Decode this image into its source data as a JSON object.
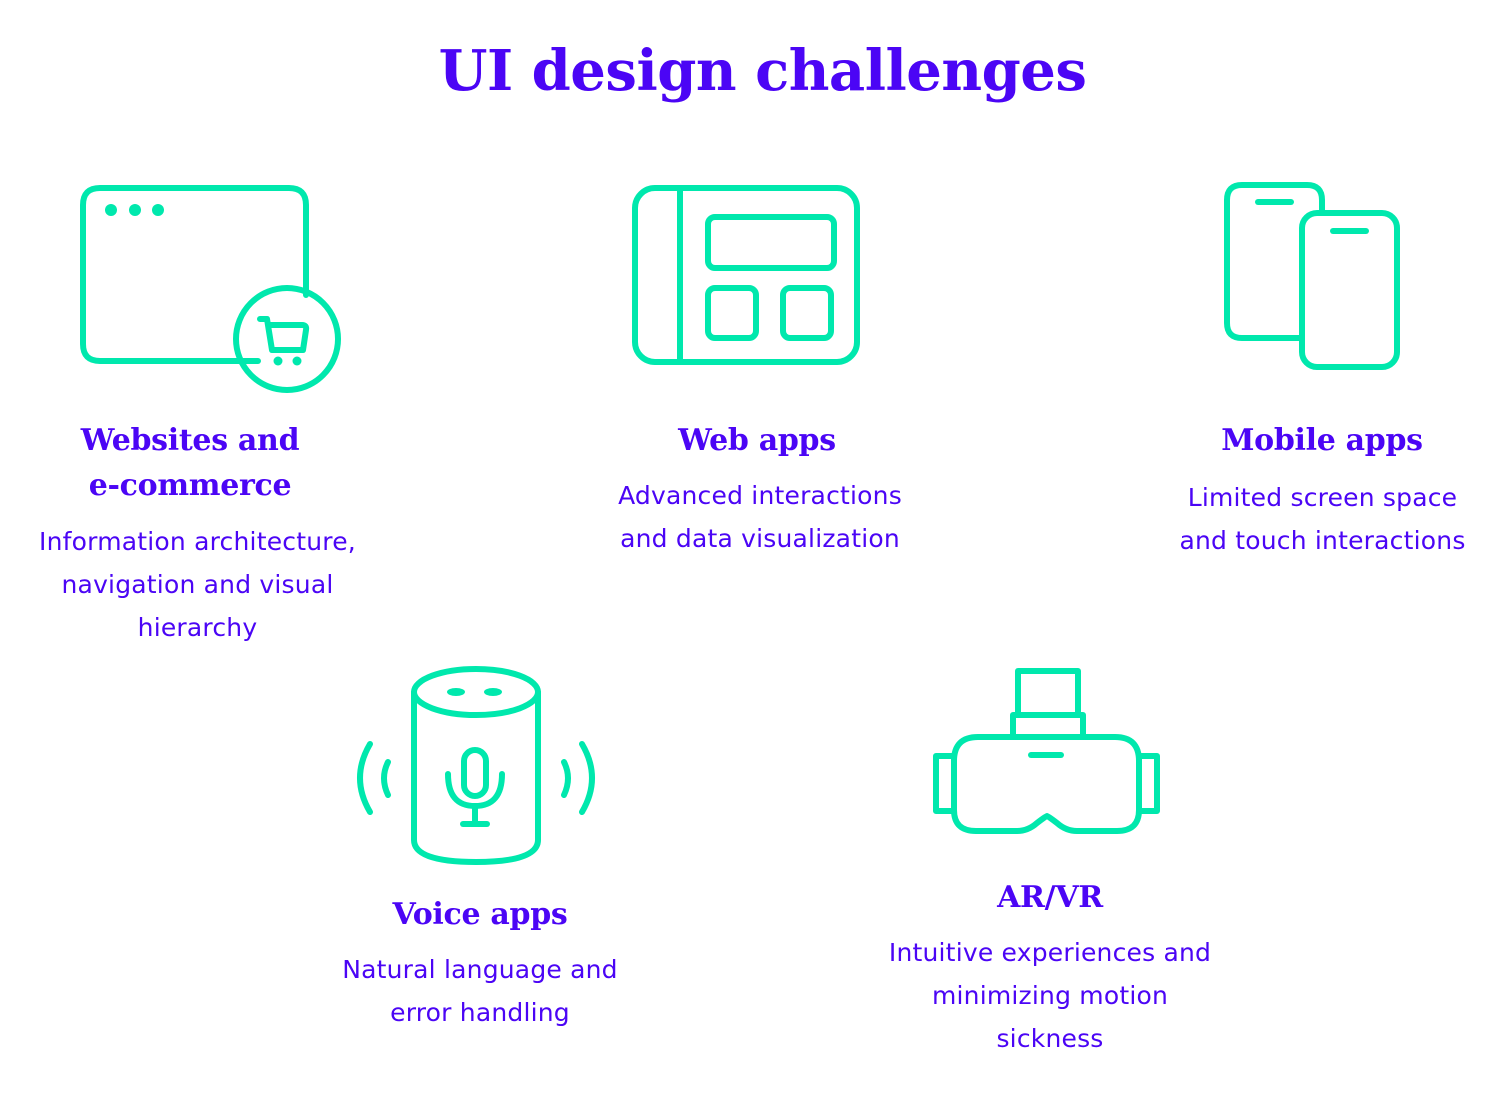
{
  "title": "UI design challenges",
  "colors": {
    "heading": "#4b05f5",
    "icon": "#00e8ad",
    "background": "#ffffff"
  },
  "cards": [
    {
      "icon": "browser-cart-icon",
      "title_lines": [
        "Websites and",
        "e-commerce"
      ],
      "desc_lines": [
        "Information architecture,",
        "navigation and visual",
        "hierarchy"
      ]
    },
    {
      "icon": "web-app-layout-icon",
      "title_lines": [
        "Web apps"
      ],
      "desc_lines": [
        "Advanced interactions",
        "and data visualization"
      ]
    },
    {
      "icon": "mobile-phones-icon",
      "title_lines": [
        "Mobile apps"
      ],
      "desc_lines": [
        "Limited screen space",
        "and touch interactions"
      ]
    },
    {
      "icon": "smart-speaker-icon",
      "title_lines": [
        "Voice apps"
      ],
      "desc_lines": [
        "Natural language and",
        "error handling"
      ]
    },
    {
      "icon": "vr-headset-icon",
      "title_lines": [
        "AR/VR"
      ],
      "desc_lines": [
        "Intuitive experiences and",
        "minimizing motion",
        "sickness"
      ]
    }
  ]
}
